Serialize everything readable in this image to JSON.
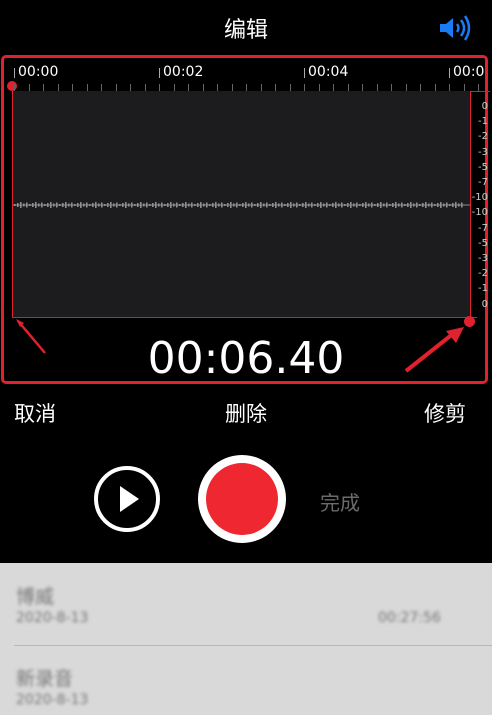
{
  "header": {
    "title": "编辑",
    "speaker_icon": "speaker-icon"
  },
  "timeline": {
    "ticks": [
      "00:00",
      "00:02",
      "00:04",
      "00:0"
    ]
  },
  "db_scale": [
    "0",
    "-1",
    "-2",
    "-3",
    "-5",
    "-7",
    "-10",
    "-10",
    "-7",
    "-5",
    "-3",
    "-2",
    "-1",
    "0"
  ],
  "time_display": "00:06.40",
  "actions": {
    "cancel": "取消",
    "delete": "删除",
    "trim": "修剪"
  },
  "controls": {
    "play_icon": "play-icon",
    "record_icon": "record-icon",
    "done": "完成"
  },
  "recordings": [
    {
      "title": "博威",
      "date": "2020-8-13",
      "duration": "00:27:56"
    },
    {
      "title": "新录音",
      "date": "2020-8-13",
      "duration": ""
    }
  ],
  "colors": {
    "accent": "#e2212f",
    "record": "#ee2730",
    "background": "#000000",
    "list_bg": "#d9d9d9"
  }
}
